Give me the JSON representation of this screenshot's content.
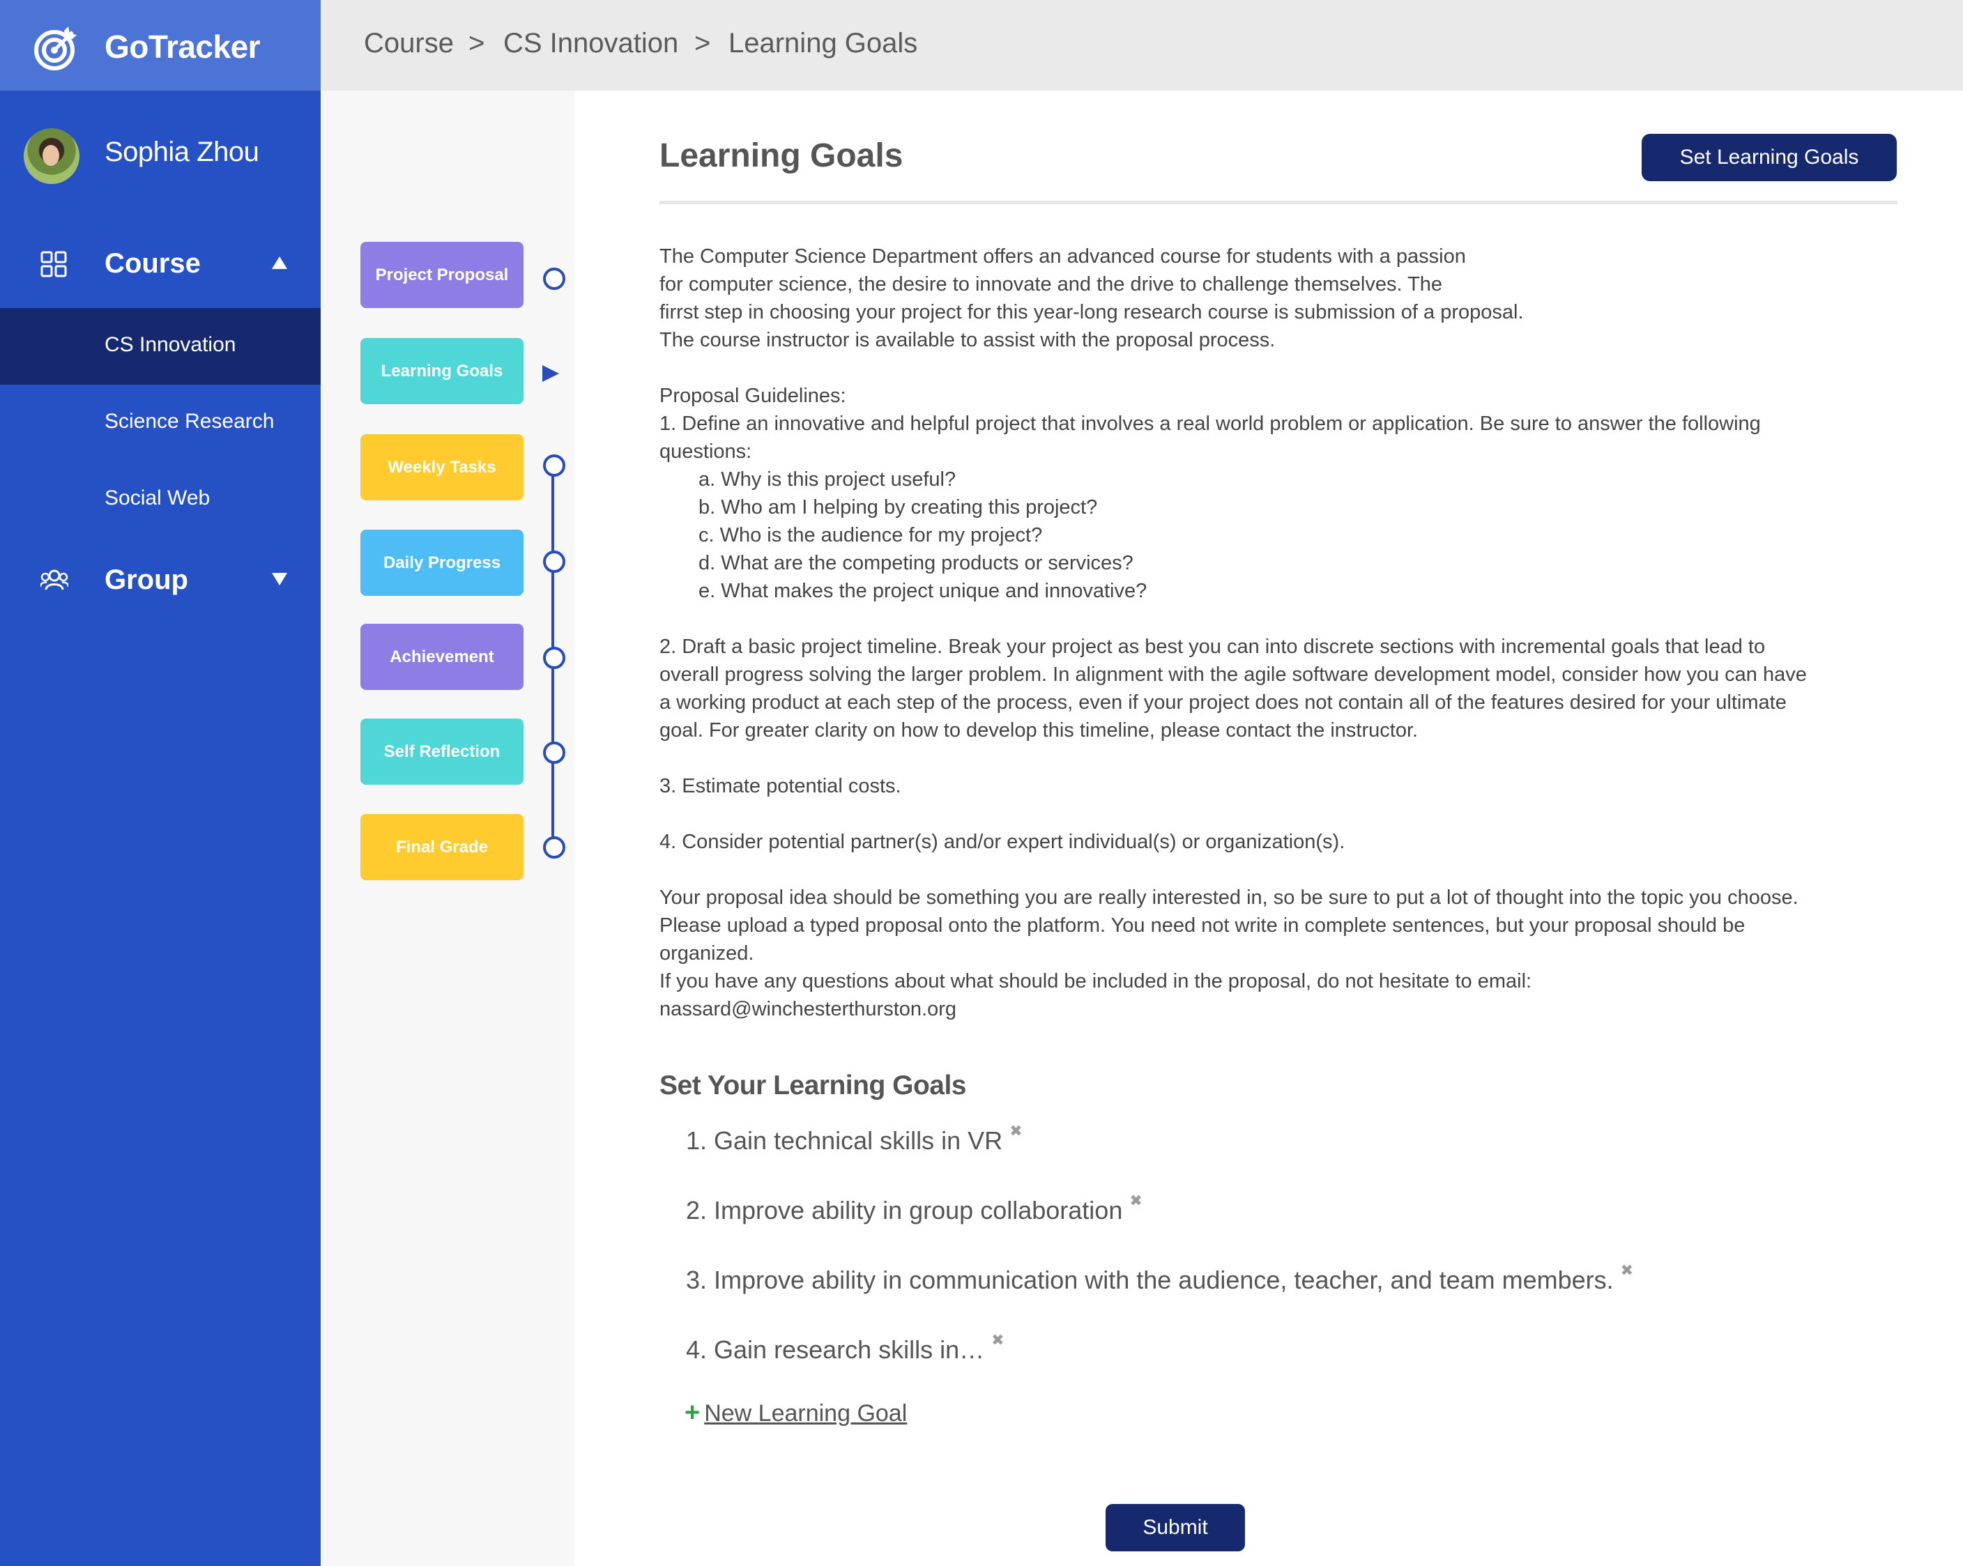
{
  "app": {
    "name": "GoTracker"
  },
  "user": {
    "name": "Sophia Zhou"
  },
  "sidebar": {
    "course_label": "Course",
    "course_items": [
      "CS Innovation",
      "Science Research",
      "Social Web"
    ],
    "group_label": "Group"
  },
  "breadcrumb": {
    "items": [
      "Course",
      "CS Innovation",
      "Learning Goals"
    ],
    "separator": ">"
  },
  "timeline": {
    "steps": [
      {
        "label": "Project Proposal",
        "color": "#8f7de6"
      },
      {
        "label": "Learning Goals",
        "color": "#4fd6d6"
      },
      {
        "label": "Weekly Tasks",
        "color": "#ffcb2e"
      },
      {
        "label": "Daily Progress",
        "color": "#4ebcf5"
      },
      {
        "label": "Achievement",
        "color": "#8f7de6"
      },
      {
        "label": "Self Reflection",
        "color": "#4fd6d6"
      },
      {
        "label": "Final Grade",
        "color": "#ffcb2e"
      }
    ],
    "current": "Learning Goals"
  },
  "main": {
    "title": "Learning Goals",
    "set_goals_button": "Set Learning Goals",
    "description_lines": [
      "The Computer Science Department offers an advanced course for students with a passion",
      "for computer science, the desire to innovate and the drive to challenge themselves. The",
      "firrst step in choosing your project for this year-long research course is submission of a proposal.",
      "The course instructor is available to assist with the proposal process.",
      "",
      "Proposal Guidelines:",
      "1. Define an innovative and helpful project that involves a real world problem or application. Be sure to answer the following",
      "questions:",
      "a. Why is this project useful?",
      "b. Who am I helping by creating this project?",
      "c. Who is the audience for my project?",
      "d. What are the competing products or services?",
      "e. What makes the project unique and innovative?",
      "",
      "2. Draft a basic project timeline. Break your project as best you can into discrete sections with incremental goals that lead to",
      "overall progress solving the larger problem. In alignment with the agile software development model, consider how you can have",
      "a working product at each step of the process, even if your project does not contain all of the features desired for your ultimate",
      "goal. For greater clarity on how to develop this timeline, please contact the instructor.",
      "",
      "3. Estimate potential costs.",
      "",
      "4. Consider potential partner(s) and/or expert individual(s) or organization(s).",
      "",
      "Your proposal idea should be something you are really interested in, so be sure to put a lot of thought into the topic you choose.",
      "Please upload a typed proposal onto the platform. You need not write in complete sentences, but your proposal should be",
      "organized.",
      "If you have any questions about what should be included in the proposal, do not hesitate to email:",
      "nassard@winchesterthurston.org"
    ],
    "goals_heading": "Set Your Learning Goals",
    "goals": [
      "1. Gain technical skills in VR",
      "2. Improve ability in group collaboration",
      "3. Improve ability in communication with the audience, teacher, and team members.",
      "4. Gain research skills in…"
    ],
    "remove_glyph": "✖",
    "new_goal_plus": "+",
    "new_goal_label": "New Learning Goal",
    "submit_button": "Submit"
  }
}
